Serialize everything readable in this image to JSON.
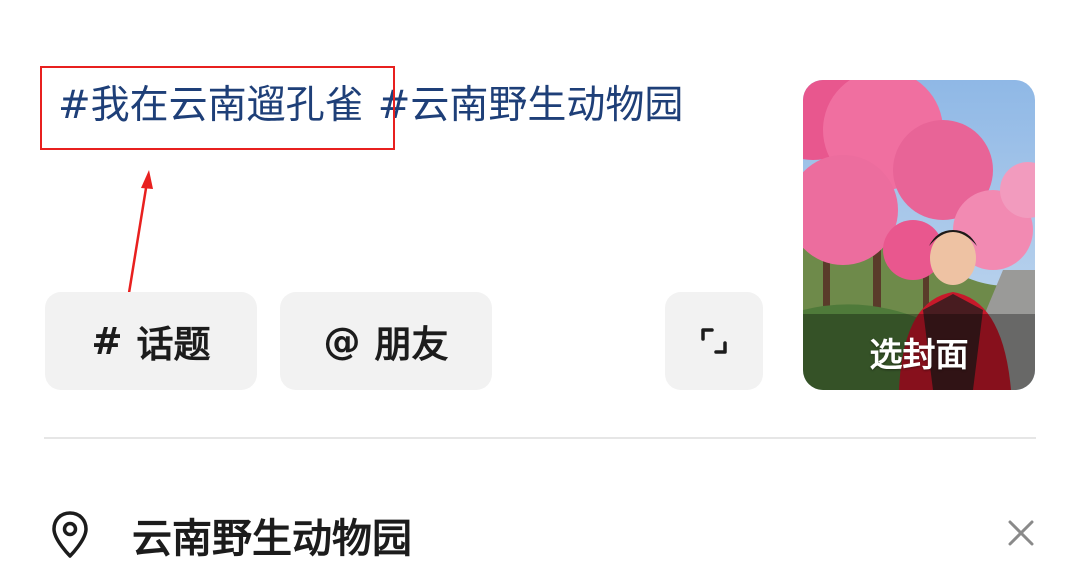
{
  "hashtags": [
    "#我在云南遛孔雀",
    "#云南野生动物园"
  ],
  "actions": {
    "topic_symbol": "#",
    "topic_label": "话题",
    "friend_symbol": "@",
    "friend_label": "朋友"
  },
  "cover": {
    "label": "选封面"
  },
  "location": {
    "name": "云南野生动物园"
  },
  "colors": {
    "hashtag": "#1e3f78",
    "annotation": "#e8201f"
  }
}
